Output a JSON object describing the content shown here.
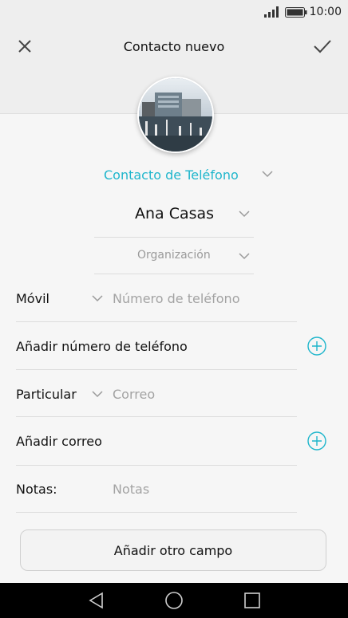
{
  "status": {
    "time": "10:00"
  },
  "header": {
    "title": "Contacto nuevo"
  },
  "account": {
    "label": "Contacto de Teléfono"
  },
  "contact": {
    "name": "Ana Casas",
    "organization_placeholder": "Organización"
  },
  "phone": {
    "type_label": "Móvil",
    "placeholder": "Número de teléfono",
    "add_label": "Añadir número de teléfono"
  },
  "email": {
    "type_label": "Particular",
    "placeholder": "Correo",
    "add_label": "Añadir correo"
  },
  "notes": {
    "label": "Notas:",
    "placeholder": "Notas"
  },
  "footer": {
    "add_field_label": "Añadir otro campo"
  },
  "colors": {
    "accent": "#1fb6cc"
  }
}
